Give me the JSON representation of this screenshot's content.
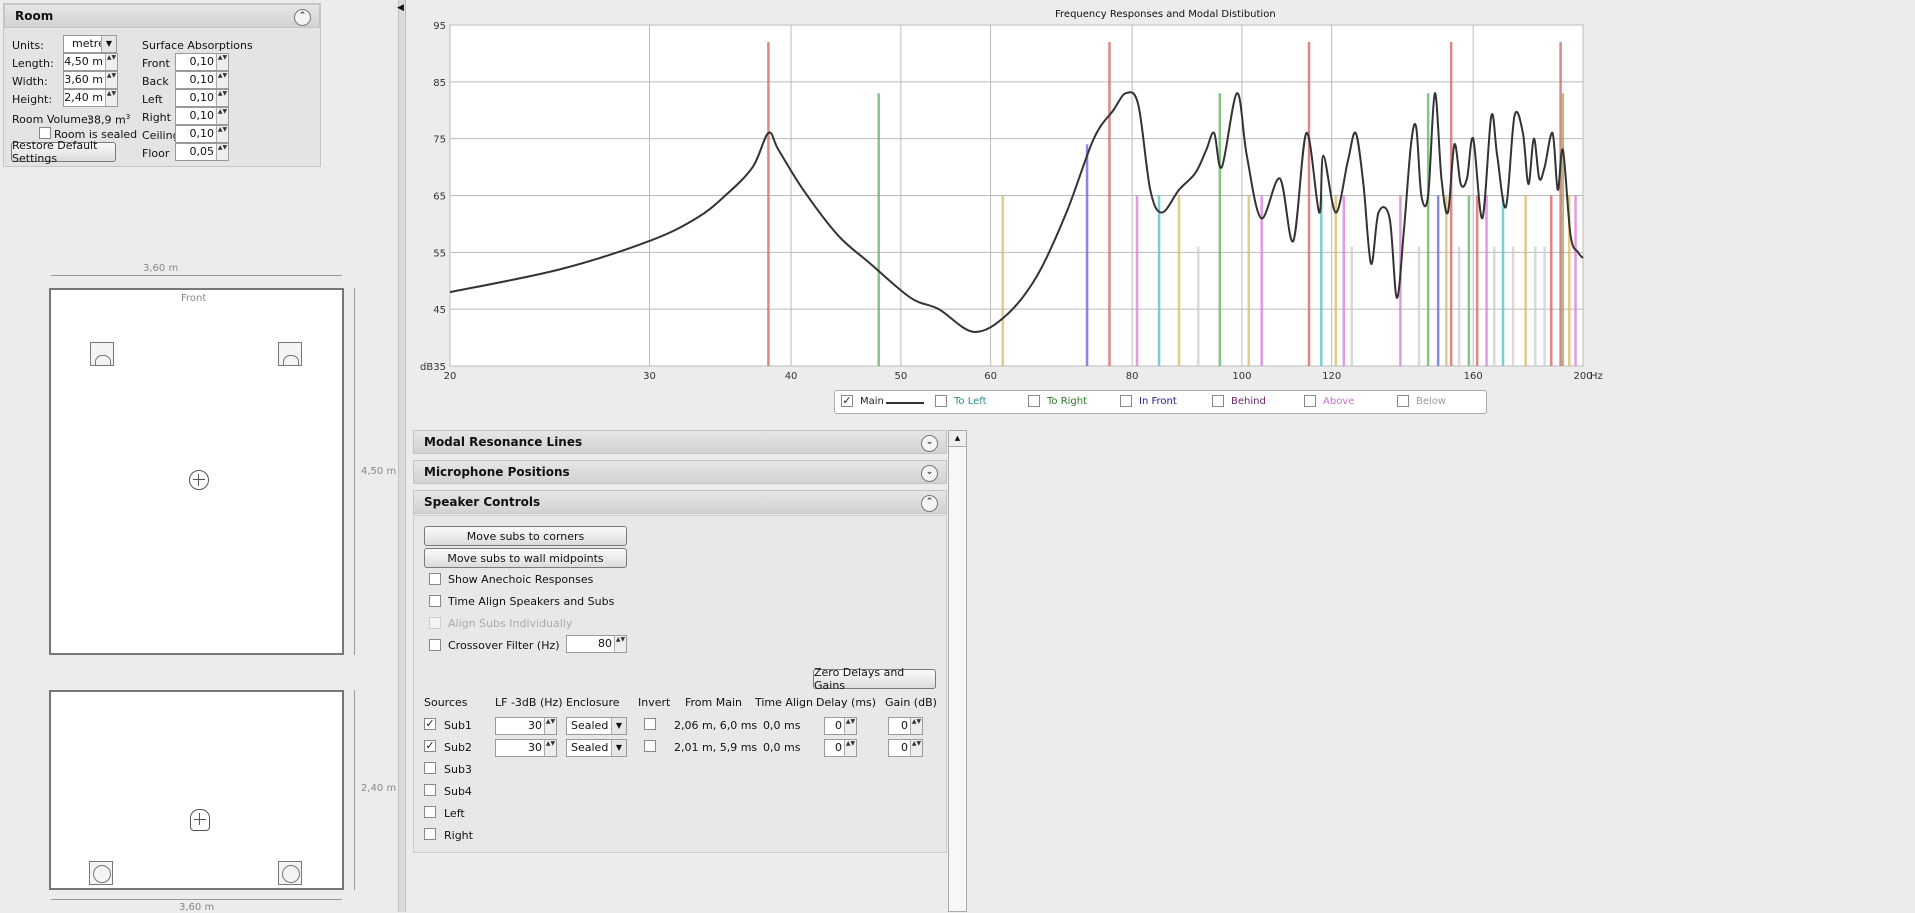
{
  "room": {
    "title": "Room",
    "units_label": "Units:",
    "units_value": "metres",
    "length_label": "Length:",
    "length_value": "4,50 m",
    "width_label": "Width:",
    "width_value": "3,60 m",
    "height_label": "Height:",
    "height_value": "2,40 m",
    "volume_label": "Room Volume:",
    "volume_value": "38,9 m",
    "volume_sup": "3",
    "sealed_label": "Room is sealed",
    "restore_label": "Restore Default Settings",
    "surface_title": "Surface Absorptions",
    "surfaces": [
      {
        "label": "Front",
        "value": "0,10"
      },
      {
        "label": "Back",
        "value": "0,10"
      },
      {
        "label": "Left",
        "value": "0,10"
      },
      {
        "label": "Right",
        "value": "0,10"
      },
      {
        "label": "Ceiling",
        "value": "0,10"
      },
      {
        "label": "Floor",
        "value": "0,05"
      }
    ]
  },
  "plan": {
    "top_width": "3,60 m",
    "front_label": "Front",
    "side_length": "4,50 m",
    "side_height": "2,40 m",
    "bottom_width": "3,60 m"
  },
  "chart_data": {
    "type": "line",
    "title": "Frequency Responses and Modal Distibution",
    "y_unit": "dB",
    "x_unit": "Hz",
    "xlim": [
      20,
      200
    ],
    "ylim": [
      35,
      95
    ],
    "x_scale": "log",
    "grid": true,
    "x_ticks": [
      20,
      30,
      40,
      50,
      60,
      80,
      100,
      120,
      160,
      200
    ],
    "y_ticks": [
      35,
      45,
      55,
      65,
      75,
      85,
      95
    ],
    "series": [
      {
        "name": "Main",
        "color": "#333333",
        "x": [
          20,
          25,
          30,
          33,
          35,
          37,
          38.2,
          39,
          41,
          44,
          47,
          51,
          54,
          58,
          62,
          66,
          70,
          74,
          77,
          79,
          81,
          83,
          85,
          88,
          91,
          93,
          94.5,
          96,
          99,
          101,
          104,
          108,
          111,
          114,
          117,
          118,
          121,
          124,
          126,
          128,
          130,
          132,
          135,
          137,
          139,
          141,
          142.5,
          144,
          146,
          148,
          150,
          152,
          154,
          156,
          158,
          160,
          163,
          166,
          168,
          171,
          174,
          177,
          179,
          181,
          183,
          185,
          188,
          190,
          192,
          195,
          198,
          200
        ],
        "y": [
          48,
          52,
          57,
          61,
          65,
          70,
          76,
          73,
          66,
          58,
          53,
          47,
          45,
          41,
          44,
          51,
          62,
          75,
          80,
          83,
          81,
          66,
          62,
          66,
          69,
          73,
          76,
          70,
          83,
          72,
          61,
          68,
          57,
          76,
          62,
          72,
          62,
          71,
          76,
          67,
          53,
          62,
          61,
          47,
          59,
          74,
          77,
          65,
          65,
          83,
          68,
          62,
          74,
          67,
          68,
          75,
          61,
          79,
          72,
          63,
          79,
          76,
          67,
          75,
          68,
          70,
          76,
          66,
          73,
          58,
          55,
          54
        ]
      }
    ],
    "modes": [
      {
        "x": 38.2,
        "y": 92,
        "color": "#d06060"
      },
      {
        "x": 47.8,
        "y": 83,
        "color": "#60b060"
      },
      {
        "x": 61.5,
        "y": 65,
        "color": "#d8b860"
      },
      {
        "x": 73.0,
        "y": 74,
        "color": "#6060d0"
      },
      {
        "x": 76.4,
        "y": 92,
        "color": "#d06060"
      },
      {
        "x": 80.8,
        "y": 65,
        "color": "#d878d8"
      },
      {
        "x": 84.5,
        "y": 65,
        "color": "#50c0c0"
      },
      {
        "x": 88.0,
        "y": 65,
        "color": "#d8b860"
      },
      {
        "x": 91.5,
        "y": 56,
        "color": "#cccccc"
      },
      {
        "x": 95.6,
        "y": 83,
        "color": "#60b060"
      },
      {
        "x": 101.4,
        "y": 65,
        "color": "#d8b860"
      },
      {
        "x": 104.1,
        "y": 65,
        "color": "#d878d8"
      },
      {
        "x": 114.6,
        "y": 92,
        "color": "#d06060"
      },
      {
        "x": 117.5,
        "y": 65,
        "color": "#50c0c0"
      },
      {
        "x": 121.0,
        "y": 65,
        "color": "#d8b860"
      },
      {
        "x": 123.0,
        "y": 65,
        "color": "#d878d8"
      },
      {
        "x": 125.0,
        "y": 56,
        "color": "#cccccc"
      },
      {
        "x": 138.0,
        "y": 65,
        "color": "#d878d8"
      },
      {
        "x": 143.3,
        "y": 56,
        "color": "#cccccc"
      },
      {
        "x": 146.0,
        "y": 83,
        "color": "#60b060"
      },
      {
        "x": 149.0,
        "y": 65,
        "color": "#6060d0"
      },
      {
        "x": 151.5,
        "y": 65,
        "color": "#d8b860"
      },
      {
        "x": 153.0,
        "y": 92,
        "color": "#d06060"
      },
      {
        "x": 155.5,
        "y": 56,
        "color": "#cccccc"
      },
      {
        "x": 158.6,
        "y": 65,
        "color": "#60b060"
      },
      {
        "x": 161.3,
        "y": 65,
        "color": "#d06060"
      },
      {
        "x": 164.4,
        "y": 65,
        "color": "#d878d8"
      },
      {
        "x": 167.0,
        "y": 56,
        "color": "#cccccc"
      },
      {
        "x": 170.0,
        "y": 65,
        "color": "#50c0c0"
      },
      {
        "x": 173.5,
        "y": 56,
        "color": "#cccccc"
      },
      {
        "x": 178.0,
        "y": 65,
        "color": "#d8b860"
      },
      {
        "x": 181.5,
        "y": 56,
        "color": "#cccccc"
      },
      {
        "x": 185.0,
        "y": 56,
        "color": "#cccccc"
      },
      {
        "x": 187.5,
        "y": 65,
        "color": "#d06060"
      },
      {
        "x": 191.1,
        "y": 92,
        "color": "#d06060"
      },
      {
        "x": 192.0,
        "y": 83,
        "color": "#a0a060"
      },
      {
        "x": 194.5,
        "y": 65,
        "color": "#d8b860"
      },
      {
        "x": 197.0,
        "y": 65,
        "color": "#d878d8"
      }
    ]
  },
  "legend": {
    "items": [
      {
        "label": "Main",
        "color": "#222222",
        "checked": "✓"
      },
      {
        "label": "To Left",
        "color": "#2a8a8a",
        "checked": ""
      },
      {
        "label": "To Right",
        "color": "#2a7a2a",
        "checked": ""
      },
      {
        "label": "In Front",
        "color": "#22228a",
        "checked": ""
      },
      {
        "label": "Behind",
        "color": "#6a2a6a",
        "checked": ""
      },
      {
        "label": "Above",
        "color": "#d070d0",
        "checked": ""
      },
      {
        "label": "Below",
        "color": "#999999",
        "checked": ""
      }
    ]
  },
  "panels": {
    "modal_title": "Modal Resonance Lines",
    "mic_title": "Microphone Positions",
    "speaker_title": "Speaker Controls"
  },
  "speaker": {
    "corners_btn": "Move subs to corners",
    "midpoints_btn": "Move subs to wall midpoints",
    "anechoic_label": "Show Anechoic Responses",
    "timealign_label": "Time Align Speakers and Subs",
    "individually_label": "Align Subs Individually",
    "crossover_label": "Crossover Filter (Hz)",
    "crossover_value": "80",
    "zero_btn": "Zero Delays and Gains",
    "headers": {
      "sources": "Sources",
      "lf": "LF -3dB (Hz)",
      "enclosure": "Enclosure",
      "invert": "Invert",
      "from_main": "From Main",
      "time_align": "Time Align",
      "delay": "Delay (ms)",
      "gain": "Gain (dB)"
    },
    "sources": [
      {
        "name": "Sub1",
        "checked": "✓",
        "lf": "30",
        "enclosure": "Sealed",
        "from_main": "2,06 m, 6,0 ms",
        "time_align": "0,0 ms",
        "delay": "0",
        "gain": "0"
      },
      {
        "name": "Sub2",
        "checked": "✓",
        "lf": "30",
        "enclosure": "Sealed",
        "from_main": "2,01 m, 5,9 ms",
        "time_align": "0,0 ms",
        "delay": "0",
        "gain": "0"
      },
      {
        "name": "Sub3",
        "checked": ""
      },
      {
        "name": "Sub4",
        "checked": ""
      },
      {
        "name": "Left",
        "checked": ""
      },
      {
        "name": "Right",
        "checked": ""
      }
    ]
  },
  "icons": {
    "collapse_up": "⌃",
    "collapse_down": "⌄",
    "dropdown": "▼",
    "spin": "▲▼",
    "splitter": "◀",
    "scroll_up": "▲"
  }
}
